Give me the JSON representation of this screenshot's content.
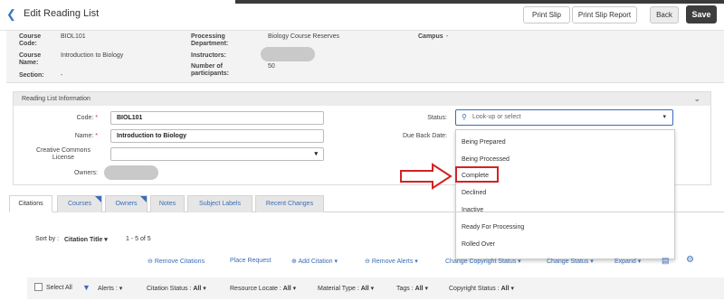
{
  "header": {
    "title": "Edit Reading List",
    "print_slip": "Print Slip",
    "print_slip_report": "Print Slip Report",
    "back": "Back",
    "save": "Save"
  },
  "course": {
    "course_code_label": "Course Code:",
    "course_code": "BIOL101",
    "course_name_label": "Course Name:",
    "course_name": "Introduction to Biology",
    "section_label": "Section:",
    "section": "-",
    "dept_label": "Processing Department:",
    "dept": "Biology Course Reserves",
    "instructors_label": "Instructors:",
    "participants_label": "Number of participants:",
    "participants": "50",
    "campus_label": "Campus",
    "campus": "-"
  },
  "reading_list": {
    "header": "Reading List Information",
    "code_label": "Code:",
    "code": "BIOL101",
    "name_label": "Name:",
    "name": "Introduction to Biology",
    "license_label": "Creative Commons License",
    "owners_label": "Owners:",
    "status_label": "Status:",
    "status_placeholder": "Look-up or select",
    "due_back_label": "Due Back Date:"
  },
  "status_options": [
    "Being Prepared",
    "Being Processed",
    "Complete",
    "Declined",
    "Inactive",
    "Ready For Processing",
    "Rolled Over"
  ],
  "tabs": [
    "Citations",
    "Courses",
    "Owners",
    "Notes",
    "Subject Labels",
    "Recent Changes"
  ],
  "list": {
    "sort_by": "Sort by :",
    "sort_field": "Citation Title",
    "range": "1 - 5 of 5",
    "remove_citations": "Remove Citations",
    "place_request": "Place Request",
    "add_citation": "Add Citation",
    "remove_alerts": "Remove Alerts",
    "change_copyright": "Change Copyright Status",
    "change_status": "Change Status",
    "expand": "Expand"
  },
  "filters": {
    "select_all": "Select All",
    "alerts": "Alerts :",
    "citation_status": "Citation Status :",
    "resource_locate": "Resource Locate :",
    "material_type": "Material Type :",
    "tags": "Tags :",
    "copyright_status": "Copyright Status :",
    "all": "All"
  },
  "colors": {
    "accent": "#3a6db5",
    "highlight": "#d42222",
    "dark_button": "#3d3d3d"
  }
}
